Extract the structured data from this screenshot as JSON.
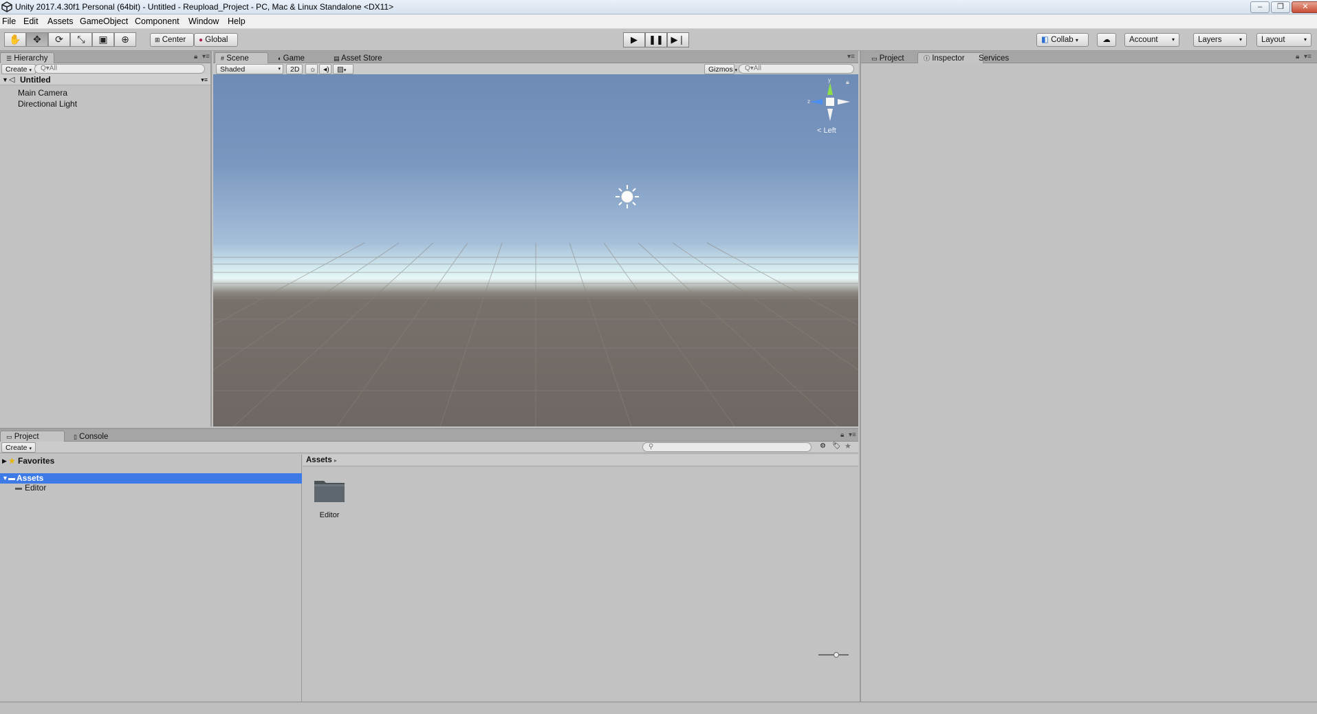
{
  "window": {
    "title": "Unity 2017.4.30f1 Personal (64bit) - Untitled - Reupload_Project - PC, Mac & Linux Standalone <DX11>",
    "controls": [
      "–",
      "❐",
      "✕"
    ]
  },
  "menu": {
    "items": [
      "File",
      "Edit",
      "Assets",
      "GameObject",
      "Component",
      "Window",
      "Help"
    ]
  },
  "toolbar": {
    "pivot_label": "Center",
    "space_label": "Global",
    "collab_label": "Collab",
    "account_label": "Account",
    "layers_label": "Layers",
    "layout_label": "Layout"
  },
  "hierarchy": {
    "tab": "Hierarchy",
    "create_label": "Create",
    "search_placeholder": "Q▾All",
    "scene_name": "Untitled",
    "items": [
      "Main Camera",
      "Directional Light"
    ]
  },
  "scene_view": {
    "tabs": [
      "Scene",
      "Game",
      "Asset Store"
    ],
    "shading_mode": "Shaded",
    "mode_2d": "2D",
    "gizmos_label": "Gizmos",
    "search_placeholder": "Q▾All",
    "orientation_label": "< Left",
    "axis_y": "y",
    "axis_z": "z"
  },
  "inspector": {
    "tabs": [
      "Project",
      "Inspector",
      "Services"
    ]
  },
  "project": {
    "tabs": [
      "Project",
      "Console"
    ],
    "create_label": "Create",
    "tree": {
      "favorites": "Favorites",
      "assets": "Assets",
      "children": [
        "Editor"
      ]
    },
    "breadcrumb": "Assets",
    "breadcrumb_arrow": "▸",
    "grid_items": [
      {
        "name": "Editor",
        "icon": "folder-icon"
      }
    ]
  },
  "colors": {
    "selection": "#3d7ae6",
    "panel_bg": "#c2c2c2",
    "tab_bar": "#a5a5a5"
  }
}
